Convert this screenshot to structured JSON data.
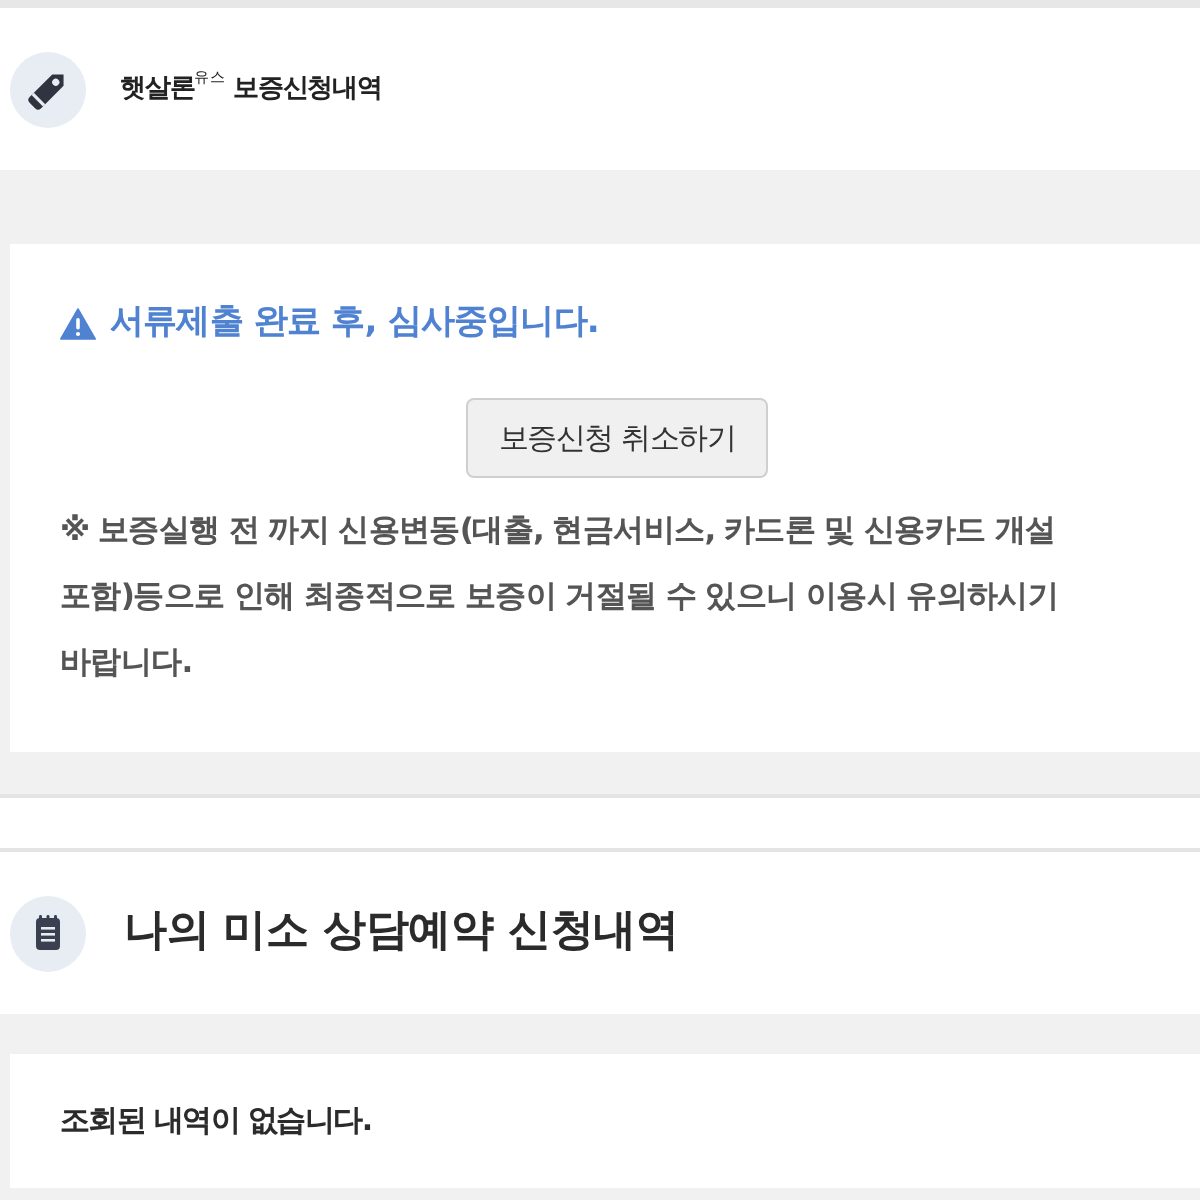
{
  "guarantee_section": {
    "title": "햇살론$^{유스}$ 보증신청내역",
    "status_message": "서류제출 완료 후, 심사중입니다.",
    "cancel_button": "보증신청 취소하기",
    "notice": "※ 보증실행 전 까지 신용변동(대출, 현금서비스, 카드론 및 신용카드 개설 포함)등으로 인해 최종적으로 보증이 거절될 수 있으니 이용시 유의하시기 바랍니다."
  },
  "consult_section": {
    "title": "나의 미소 상담예약 신청내역",
    "empty_message": "조회된 내역이 없습니다."
  }
}
